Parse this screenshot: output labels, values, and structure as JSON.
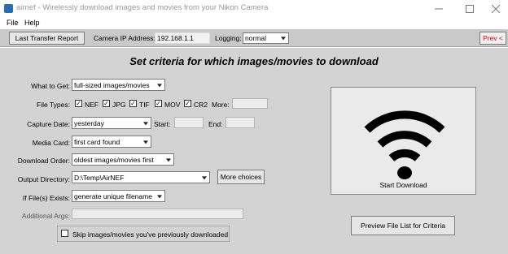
{
  "window": {
    "title": "airnef - Wirelessly download images and movies from your Nikon Camera"
  },
  "menu": {
    "file": "File",
    "help": "Help"
  },
  "toolbar": {
    "last_transfer_report": "Last Transfer Report",
    "camera_ip_label": "Camera IP Address:",
    "camera_ip_value": "192.168.1.1",
    "logging_label": "Logging:",
    "logging_value": "normal",
    "prev_label": "Prev <"
  },
  "heading": "Set criteria for which images/movies to download",
  "form": {
    "what_to_get_label": "What to Get:",
    "what_to_get_value": "full-sized images/movies",
    "file_types_label": "File Types:",
    "file_types": [
      {
        "label": "NEF",
        "checked": true
      },
      {
        "label": "JPG",
        "checked": true
      },
      {
        "label": "TIF",
        "checked": true
      },
      {
        "label": "MOV",
        "checked": true
      },
      {
        "label": "CR2",
        "checked": true
      }
    ],
    "more_label": "More:",
    "more_value": "",
    "capture_date_label": "Capture Date:",
    "capture_date_value": "yesterday",
    "start_label": "Start:",
    "start_value": "",
    "end_label": "End:",
    "end_value": "",
    "media_card_label": "Media Card:",
    "media_card_value": "first card found",
    "download_order_label": "Download Order:",
    "download_order_value": "oldest images/movies first",
    "output_dir_label": "Output Directory:",
    "output_dir_value": "D:\\Temp\\AirNEF",
    "more_choices": "More choices",
    "if_exists_label": "If File(s) Exists:",
    "if_exists_value": "generate unique filename",
    "additional_args_label": "Additional Args:",
    "additional_args_value": "",
    "skip_label": "Skip images/movies you've previously downloaded",
    "skip_checked": false
  },
  "start_download": "Start Download",
  "preview_button": "Preview File List for Criteria",
  "colors": {
    "prev_text": "#e00000",
    "toolbar_bg": "#c9c9c9",
    "panel_bg": "#d3d3d3"
  }
}
